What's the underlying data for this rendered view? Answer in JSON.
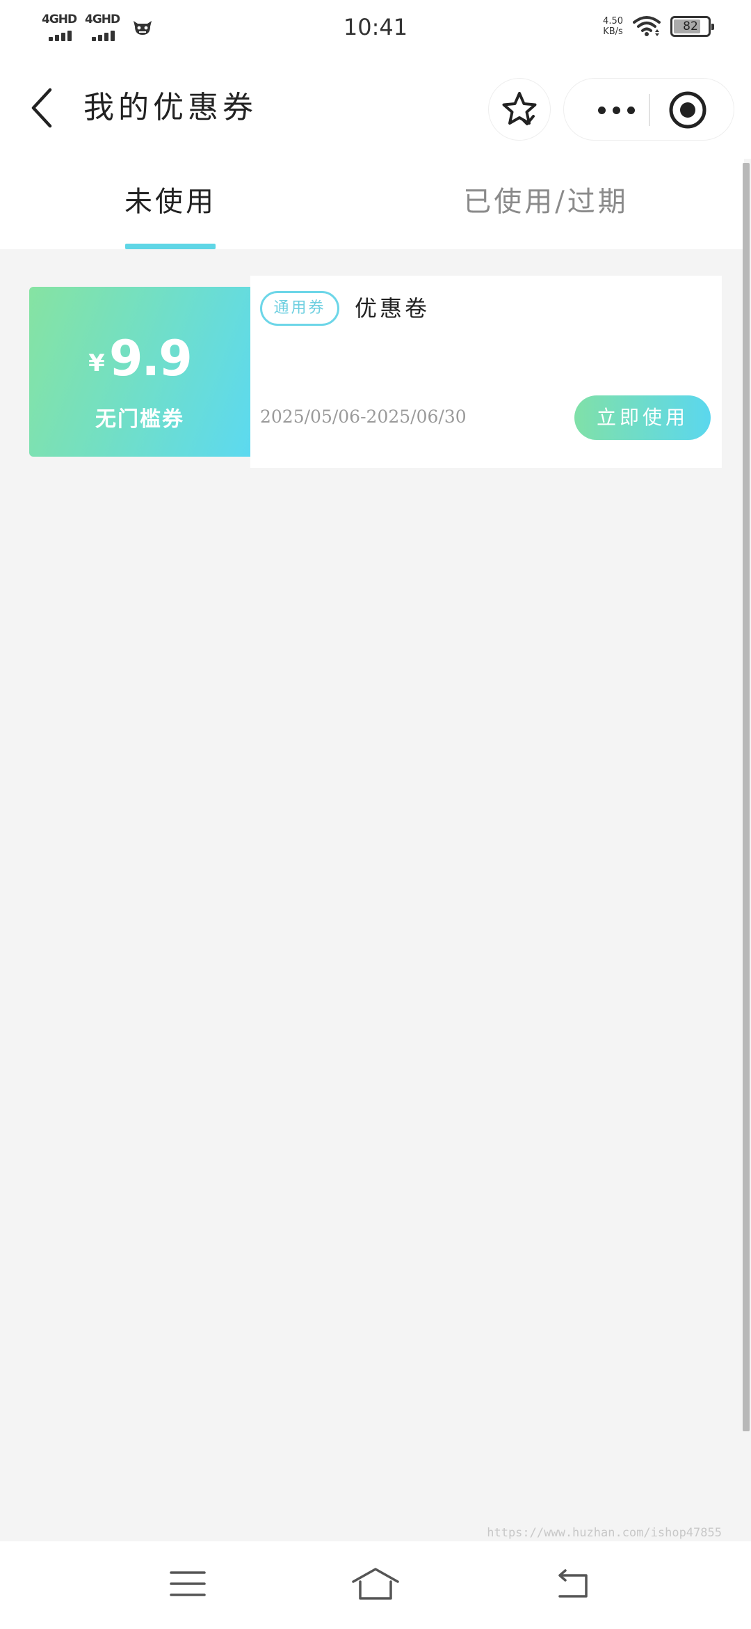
{
  "status_bar": {
    "time": "10:41",
    "signal_1": "4GHD",
    "signal_2": "4GHD",
    "net_speed_value": "4.50",
    "net_speed_unit": "KB/s",
    "battery": "82",
    "battery_level": 0.82
  },
  "header": {
    "title": "我的优惠券"
  },
  "tabs": [
    {
      "label": "未使用",
      "active": true
    },
    {
      "label": "已使用/过期",
      "active": false
    }
  ],
  "coupon": {
    "currency": "¥",
    "amount": "9.9",
    "kind": "无门槛券",
    "tag": "通用券",
    "name": "优惠卷",
    "validity": "2025/05/06-2025/06/30",
    "action": "立即使用"
  },
  "watermark": "https://www.huzhan.com/ishop47855",
  "colors": {
    "accent": "#5fd6e6",
    "gradient_start": "#86e3a2",
    "gradient_end": "#5cd9f0",
    "background": "#f4f4f4"
  },
  "icons": {
    "back": "chevron-left-icon",
    "favorite": "star-check-icon",
    "more": "more-dots-icon",
    "close": "target-circle-icon",
    "nav_menu": "menu-lines-icon",
    "nav_home": "home-icon",
    "nav_back": "return-arrow-icon"
  }
}
